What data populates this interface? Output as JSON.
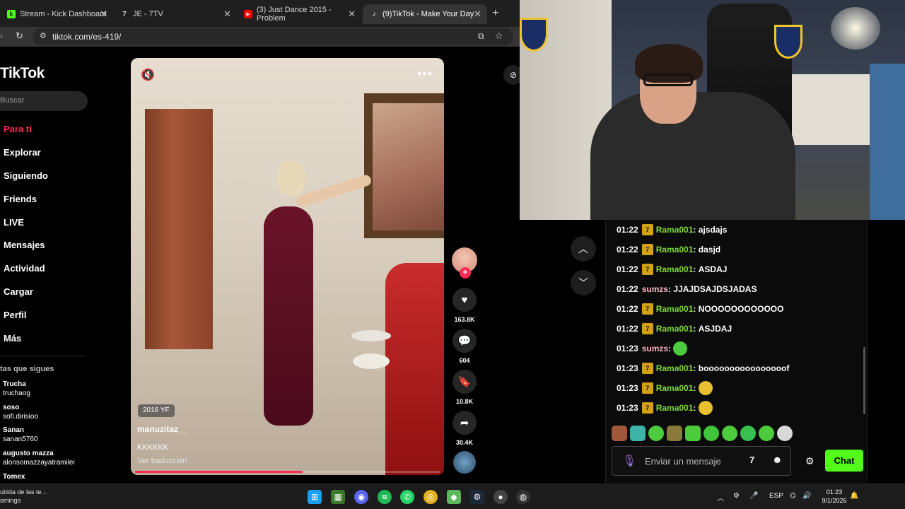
{
  "browser": {
    "tabs": [
      {
        "label": "Stream - Kick Dashboard",
        "icon": "kick-icon",
        "active": false
      },
      {
        "label": "JE - 7TV",
        "icon": "7tv-icon",
        "active": false
      },
      {
        "label": "(3) Just Dance 2015 - Problem",
        "icon": "youtube-icon",
        "active": false
      },
      {
        "label": "(9)TikTok - Make Your Day",
        "icon": "tiktok-icon",
        "active": true
      }
    ],
    "url": "tiktok.com/es-419/"
  },
  "tiktok": {
    "logo": "TikTok",
    "search_placeholder": "Buscar",
    "nav": [
      "Para ti",
      "Explorar",
      "Siguiendo",
      "Friends",
      "LIVE",
      "Mensajes",
      "Actividad",
      "Cargar",
      "Perfil",
      "Más"
    ],
    "following_title": "tas que sigues",
    "following": [
      {
        "name": "Trucha",
        "handle": "truchaog"
      },
      {
        "name": "soso",
        "handle": "sofi.dirisioo"
      },
      {
        "name": "Sanan",
        "handle": "sanan5760"
      },
      {
        "name": "augusto mazza",
        "handle": "alonsomazzayatramilei"
      },
      {
        "name": "Tomex",
        "handle": ""
      }
    ],
    "video": {
      "badge": "2016 YF",
      "author": "manuzitaz__",
      "caption": "KKKKKK",
      "translate": "Ver traducción",
      "progress": 0.55
    },
    "actions": {
      "likes": "163.8K",
      "comments": "604",
      "saves": "10.8K",
      "shares": "30.4K"
    }
  },
  "chat": {
    "messages": [
      {
        "time": "01:22",
        "user": "Rama001",
        "badge": true,
        "text": "ajsdajs"
      },
      {
        "time": "01:22",
        "user": "Rama001",
        "badge": true,
        "text": "dasjd"
      },
      {
        "time": "01:22",
        "user": "Rama001",
        "badge": true,
        "text": "ASDAJ"
      },
      {
        "time": "01:22",
        "user": "sumzs",
        "badge": false,
        "text": "JJAJDSAJDSJADAS"
      },
      {
        "time": "01:22",
        "user": "Rama001",
        "badge": true,
        "text": "NOOOOOOOOOOOO"
      },
      {
        "time": "01:22",
        "user": "Rama001",
        "badge": true,
        "text": "ASJDAJ"
      },
      {
        "time": "01:23",
        "user": "sumzs",
        "badge": false,
        "text": "",
        "emote": "green"
      },
      {
        "time": "01:23",
        "user": "Rama001",
        "badge": true,
        "text": "boooooooooooooooof"
      },
      {
        "time": "01:23",
        "user": "Rama001",
        "badge": true,
        "text": "",
        "emote": "yellow"
      },
      {
        "time": "01:23",
        "user": "Rama001",
        "badge": true,
        "text": "",
        "emote": "yellow"
      }
    ],
    "input_placeholder": "Enviar un mensaje",
    "send_label": "Chat"
  },
  "taskbar": {
    "left_line1": "ubida de las te...",
    "left_line2": "omingo",
    "lang": "ESP",
    "time": "01:23",
    "date": "9/1/2026"
  }
}
